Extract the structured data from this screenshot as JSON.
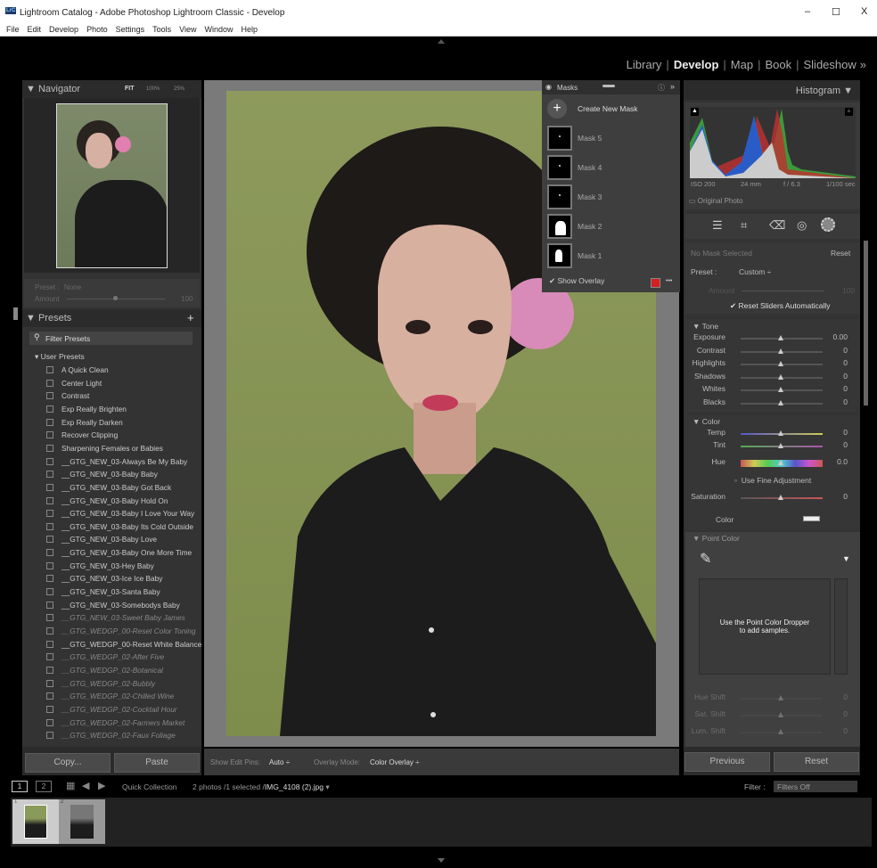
{
  "window": {
    "title": "Lightroom Catalog - Adobe Photoshop Lightroom Classic - Develop",
    "app_badge": "LrC",
    "minimize": "–",
    "maximize": "☐",
    "close": "X"
  },
  "menu": [
    "File",
    "Edit",
    "Develop",
    "Photo",
    "Settings",
    "Tools",
    "View",
    "Window",
    "Help"
  ],
  "modules": {
    "items": [
      "Library",
      "Develop",
      "Map",
      "Book",
      "Slideshow"
    ],
    "more": "»",
    "active": "Develop"
  },
  "navigator": {
    "title": "Navigator",
    "zoom_options": [
      "FIT",
      "100%",
      "25%"
    ]
  },
  "preset_amount": {
    "preset_label": "Preset :",
    "preset_value": "None",
    "amount_label": "Amount",
    "amount_value": "100",
    "amount_fraction": 0.5
  },
  "presets": {
    "title": "Presets",
    "add": "+",
    "filter_placeholder": "Filter Presets",
    "group": "User Presets",
    "items": [
      {
        "label": "A Quick Clean",
        "dim": false
      },
      {
        "label": "Center Light",
        "dim": false
      },
      {
        "label": "Contrast",
        "dim": false
      },
      {
        "label": "Exp Really Brighten",
        "dim": false
      },
      {
        "label": "Exp Really Darken",
        "dim": false
      },
      {
        "label": "Recover Clipping",
        "dim": false
      },
      {
        "label": "Sharpening Females or Babies",
        "dim": false
      },
      {
        "label": "__GTG_NEW_03-Always Be My Baby",
        "dim": false
      },
      {
        "label": "__GTG_NEW_03-Baby Baby",
        "dim": false
      },
      {
        "label": "__GTG_NEW_03-Baby Got Back",
        "dim": false
      },
      {
        "label": "__GTG_NEW_03-Baby Hold On",
        "dim": false
      },
      {
        "label": "__GTG_NEW_03-Baby I Love Your Way",
        "dim": false
      },
      {
        "label": "__GTG_NEW_03-Baby Its Cold Outside",
        "dim": false
      },
      {
        "label": "__GTG_NEW_03-Baby Love",
        "dim": false
      },
      {
        "label": "__GTG_NEW_03-Baby One More Time",
        "dim": false
      },
      {
        "label": "__GTG_NEW_03-Hey Baby",
        "dim": false
      },
      {
        "label": "__GTG_NEW_03-Ice Ice Baby",
        "dim": false
      },
      {
        "label": "__GTG_NEW_03-Santa Baby",
        "dim": false
      },
      {
        "label": "__GTG_NEW_03-Somebodys Baby",
        "dim": false
      },
      {
        "label": "__GTG_NEW_03-Sweet Baby James",
        "dim": true
      },
      {
        "label": "__GTG_WEDGP_00-Reset Color Toning",
        "dim": true
      },
      {
        "label": "__GTG_WEDGP_00-Reset White Balance",
        "dim": false
      },
      {
        "label": "__GTG_WEDGP_02-After Five",
        "dim": true
      },
      {
        "label": "__GTG_WEDGP_02-Botanical",
        "dim": true
      },
      {
        "label": "__GTG_WEDGP_02-Bubbly",
        "dim": true
      },
      {
        "label": "__GTG_WEDGP_02-Chilled Wine",
        "dim": true
      },
      {
        "label": "__GTG_WEDGP_02-Cocktail Hour",
        "dim": true
      },
      {
        "label": "__GTG_WEDGP_02-Farmers Market",
        "dim": true
      },
      {
        "label": "__GTG_WEDGP_02-Faux Foliage",
        "dim": true
      }
    ]
  },
  "left_buttons": {
    "copy": "Copy...",
    "paste": "Paste"
  },
  "toolbar": {
    "edit_pins_label": "Show Edit Pins:",
    "edit_pins_value": "Auto",
    "overlay_label": "Overlay Mode:",
    "overlay_value": "Color Overlay"
  },
  "masks": {
    "title": "Masks",
    "create": "Create New Mask",
    "items": [
      "Mask 5",
      "Mask 4",
      "Mask 3",
      "Mask 2",
      "Mask 1"
    ],
    "show_overlay": "Show Overlay",
    "overlay_color": "#d42020",
    "more": "•••"
  },
  "histogram": {
    "title": "Histogram",
    "iso": "ISO 200",
    "focal": "24 mm",
    "aperture": "f / 6.3",
    "shutter": "1/100 sec",
    "original_photo": "Original Photo"
  },
  "mask_panel": {
    "no_mask": "No Mask Selected",
    "reset": "Reset",
    "preset_label": "Preset :",
    "preset_value": "Custom",
    "amount_label": "Amount",
    "amount_value": "100",
    "reset_sliders": "Reset Sliders Automatically"
  },
  "tone": {
    "title": "Tone",
    "sliders": [
      {
        "label": "Exposure",
        "value": "0.00"
      },
      {
        "label": "Contrast",
        "value": "0"
      },
      {
        "label": "Highlights",
        "value": "0"
      },
      {
        "label": "Shadows",
        "value": "0"
      },
      {
        "label": "Whites",
        "value": "0"
      },
      {
        "label": "Blacks",
        "value": "0"
      }
    ]
  },
  "color": {
    "title": "Color",
    "temp": {
      "label": "Temp",
      "value": "0"
    },
    "tint": {
      "label": "Tint",
      "value": "0"
    },
    "hue": {
      "label": "Hue",
      "value": "0.0"
    },
    "fine": "Use Fine Adjustment",
    "saturation": {
      "label": "Saturation",
      "value": "0"
    },
    "color_label": "Color"
  },
  "point_color": {
    "title": "Point Color",
    "hint1": "Use the Point Color Dropper",
    "hint2": "to add samples.",
    "sliders": [
      {
        "label": "Hue Shift",
        "value": "0"
      },
      {
        "label": "Sat. Shift",
        "value": "0"
      },
      {
        "label": "Lum. Shift",
        "value": "0"
      }
    ]
  },
  "right_buttons": {
    "previous": "Previous",
    "reset": "Reset"
  },
  "filmstrip": {
    "view1": "1",
    "view2": "2",
    "source": "Quick Collection",
    "info": "2 photos /1 selected /",
    "filename": "IMG_4108 (2).jpg",
    "filter_label": "Filter :",
    "filter_value": "Filters Off",
    "thumbs": [
      "1",
      "2"
    ]
  }
}
